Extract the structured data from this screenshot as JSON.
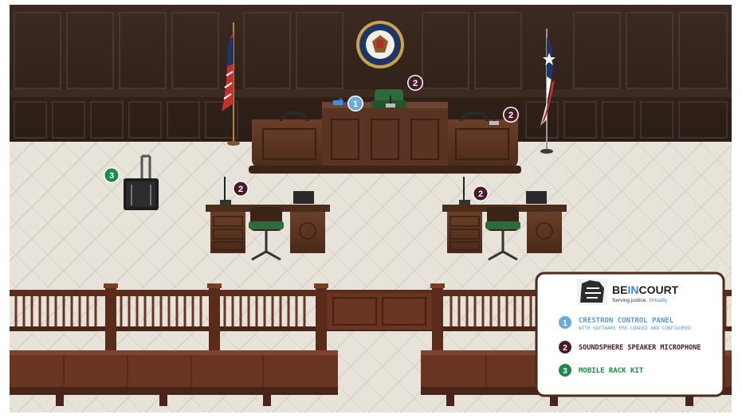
{
  "scene": {
    "badges": [
      {
        "number": "1",
        "color": "#6fa9d8"
      },
      {
        "number": "2",
        "color": "#4a1a2a"
      },
      {
        "number": "2",
        "color": "#4a1a2a"
      },
      {
        "number": "2",
        "color": "#4a1a2a"
      },
      {
        "number": "2",
        "color": "#4a1a2a"
      },
      {
        "number": "3",
        "color": "#1e8a4a"
      }
    ]
  },
  "legend": {
    "logo": {
      "brand_prefix": "BE",
      "brand_highlight": "IN",
      "brand_suffix": "COURT",
      "tagline_main": "Serving justice.",
      "tagline_accent": "Virtually."
    },
    "items": [
      {
        "number": "1",
        "title": "CRESTRON CONTROL PANEL",
        "subtitle": "WITH SOFTWARE PRE-LOADED AND CONFIGURED",
        "color": "#6fa9d8"
      },
      {
        "number": "2",
        "title": "SOUNDSPHERE SPEAKER MICROPHONE",
        "subtitle": "",
        "color": "#4a1a2a"
      },
      {
        "number": "3",
        "title": "MOBILE RACK KIT",
        "subtitle": "",
        "color": "#1e8a4a"
      }
    ]
  }
}
